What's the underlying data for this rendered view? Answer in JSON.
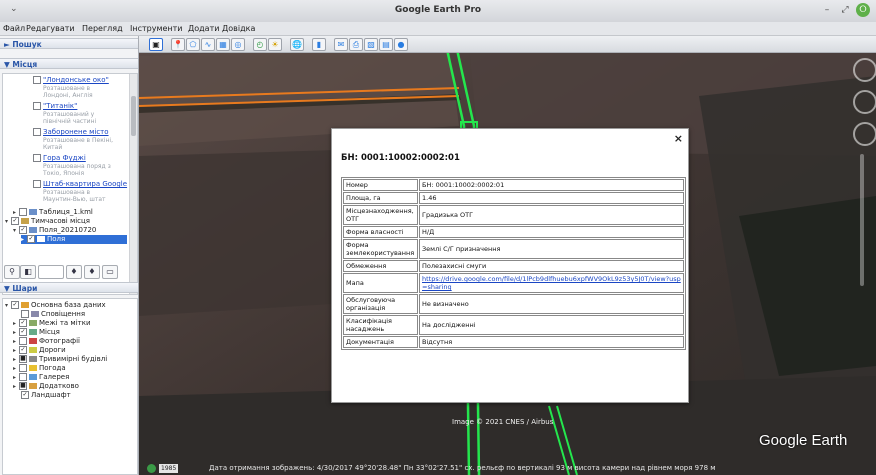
{
  "window": {
    "title": "Google Earth Pro",
    "menu_glyph": "⌄",
    "ctrl_min": "–",
    "ctrl_max": "⤢",
    "ctrl_close": "⭘"
  },
  "menu": [
    "Файл",
    "Редагувати",
    "Перегляд",
    "Інструменти",
    "Додати",
    "Довідка"
  ],
  "sidebar": {
    "search_label": "► Пошук",
    "places_label": "▼ Місця",
    "layers_label": "▼ Шари",
    "places_items": [
      {
        "label": "\"Лондонське око\"",
        "sub": [
          "Розташоване в",
          "Лондоні, Англія"
        ]
      },
      {
        "label": "\"Титанік\"",
        "sub": [
          "Розташований у",
          "північній частині"
        ]
      },
      {
        "label": "Заборонене місто",
        "sub": [
          "Розташоване в Пекіні,",
          "Китай"
        ]
      },
      {
        "label": "Гора Фуджі",
        "sub": [
          "Розташована поряд з",
          "Токіо, Японія"
        ]
      },
      {
        "label": "Штаб-квартира Google",
        "sub": [
          "Розташована в",
          "Маунтин-Вью, штат"
        ]
      }
    ],
    "tree": {
      "table_kml": "Таблиця_1.kml",
      "temp_places": "Тимчасові місця",
      "fields_date": "Поля_20210720",
      "fields": "Поля"
    },
    "layers_items": [
      "Основна база даних",
      "Сповіщення",
      "Межі та мітки",
      "Місця",
      "Фотографії",
      "Дороги",
      "Тривимірні будівлі",
      "Погода",
      "Галерея",
      "Додатково",
      "Ландшафт"
    ]
  },
  "popup": {
    "title": "БН: 0001:10002:0002:01",
    "close": "×",
    "rows": [
      {
        "key": "Номер",
        "value": "БН: 0001:10002:0002:01"
      },
      {
        "key": "Площа, га",
        "value": "1.46"
      },
      {
        "key": "Місцезнаходження, ОТГ",
        "value": "Градизька ОТГ"
      },
      {
        "key": "Форма власності",
        "value": "Н/Д"
      },
      {
        "key": "Форма землекористування",
        "value": "Землі С/Г призначення"
      },
      {
        "key": "Обмеження",
        "value": "Полезахисні смуги"
      },
      {
        "key": "Мапа",
        "value": "https://drive.google.com/file/d/1lPcb9dlfhuebu6xpfWV9OkL9z53y5J0T/view?usp=sharing",
        "is_link": true
      },
      {
        "key": "Обслуговуюча організація",
        "value": "Не визначено"
      },
      {
        "key": "Класифікація насаджень",
        "value": "На дослідженні"
      },
      {
        "key": "Документація",
        "value": "Відсутня"
      }
    ]
  },
  "map": {
    "credit": "Image © 2021 CNES / Airbus",
    "brand": "Google Earth",
    "status": "Дата отримання зображень: 4/30/2017     49°20'28.48\" Пн    33°02'27.51\" сх.  рельєф по вертикалі   93 м     висота камери над рівнем моря   978 м",
    "status_year": "1985"
  },
  "colors": {
    "parcel_outline": "#24e64d",
    "orange_line": "#e87a1e",
    "link": "#1a46c4"
  }
}
